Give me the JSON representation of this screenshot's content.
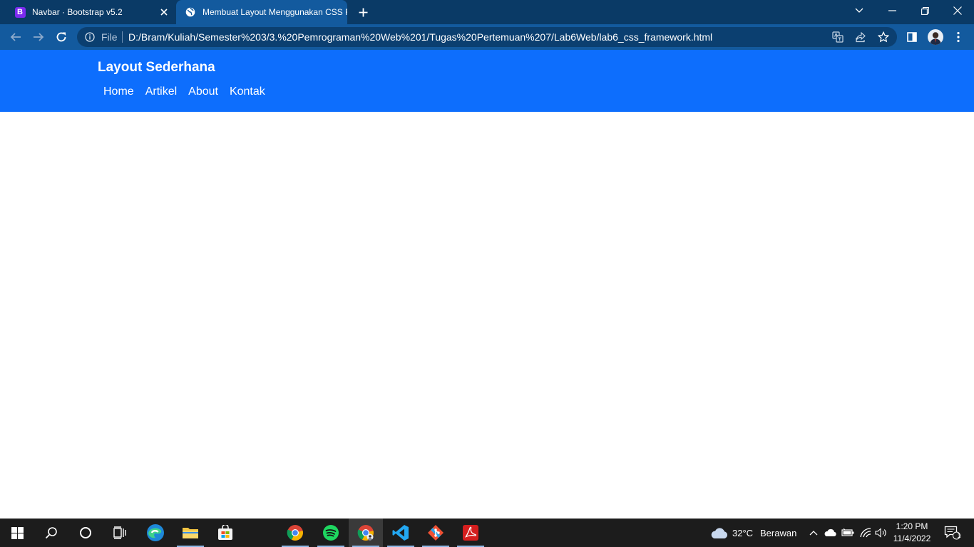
{
  "browser": {
    "tabs": [
      {
        "title": "Navbar · Bootstrap v5.2",
        "favicon": "bootstrap-icon",
        "active": false
      },
      {
        "title": "Membuat Layout Menggunakan CSS Framework",
        "favicon": "globe-icon",
        "active": true
      }
    ],
    "omnibox": {
      "scheme_label": "File",
      "url": "D:/Bram/Kuliah/Semester%203/3.%20Pemrograman%20Web%201/Tugas%20Pertemuan%207/Lab6Web/lab6_css_framework.html"
    }
  },
  "page": {
    "brand": "Layout Sederhana",
    "nav_links": [
      "Home",
      "Artikel",
      "About",
      "Kontak"
    ],
    "navbar_color": "#0d6efd"
  },
  "taskbar": {
    "weather": {
      "temperature": "32°C",
      "condition": "Berawan"
    },
    "clock": {
      "time": "1:20 PM",
      "date": "11/4/2022"
    },
    "notification_count": "1",
    "apps": [
      "start-icon",
      "search-icon",
      "cortana-icon",
      "task-view-icon",
      "edge-icon",
      "file-explorer-icon",
      "store-icon",
      "chrome-icon",
      "spotify-icon",
      "chrome-profile-icon",
      "vscode-icon",
      "git-icon",
      "acrobat-icon"
    ]
  },
  "colors": {
    "titlebar": "#0a3a66",
    "toolbar": "#135a9e",
    "taskbar": "#1c1c1c"
  }
}
